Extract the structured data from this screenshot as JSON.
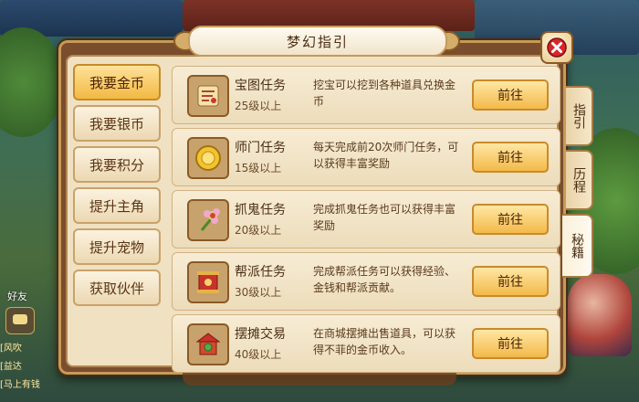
{
  "title": "梦幻指引",
  "background": {
    "chat_label": "好友",
    "chat_lines": [
      "[风吹",
      "[益达",
      "[马上有钱"
    ]
  },
  "categories": [
    {
      "label": "我要金币",
      "active": true
    },
    {
      "label": "我要银币",
      "active": false
    },
    {
      "label": "我要积分",
      "active": false
    },
    {
      "label": "提升主角",
      "active": false
    },
    {
      "label": "提升宠物",
      "active": false
    },
    {
      "label": "获取伙伴",
      "active": false
    }
  ],
  "tasks": [
    {
      "name": "宝图任务",
      "level": "25级以上",
      "desc": "挖宝可以挖到各种道具兑换金币",
      "button": "前往",
      "icon": "treasure-map-icon"
    },
    {
      "name": "师门任务",
      "level": "15级以上",
      "desc": "每天完成前20次师门任务，可以获得丰富奖励",
      "button": "前往",
      "icon": "gold-coin-icon"
    },
    {
      "name": "抓鬼任务",
      "level": "20级以上",
      "desc": "完成抓鬼任务也可以获得丰富奖励",
      "button": "前往",
      "icon": "flower-icon"
    },
    {
      "name": "帮派任务",
      "level": "30级以上",
      "desc": "完成帮派任务可以获得经验、金钱和帮派贡献。",
      "button": "前往",
      "icon": "scroll-banner-icon"
    },
    {
      "name": "摆摊交易",
      "level": "40级以上",
      "desc": "在商城摆摊出售道具，可以获得不菲的金币收入。",
      "button": "前往",
      "icon": "market-stall-icon"
    }
  ],
  "side_tabs": [
    {
      "label": "指引",
      "active": false
    },
    {
      "label": "历程",
      "active": false
    },
    {
      "label": "秘籍",
      "active": true
    }
  ],
  "colors": {
    "accent_gold": "#f3b949",
    "panel_bg": "#efe1c2",
    "frame_brown": "#7a4e2c",
    "close_red": "#d8262a"
  }
}
